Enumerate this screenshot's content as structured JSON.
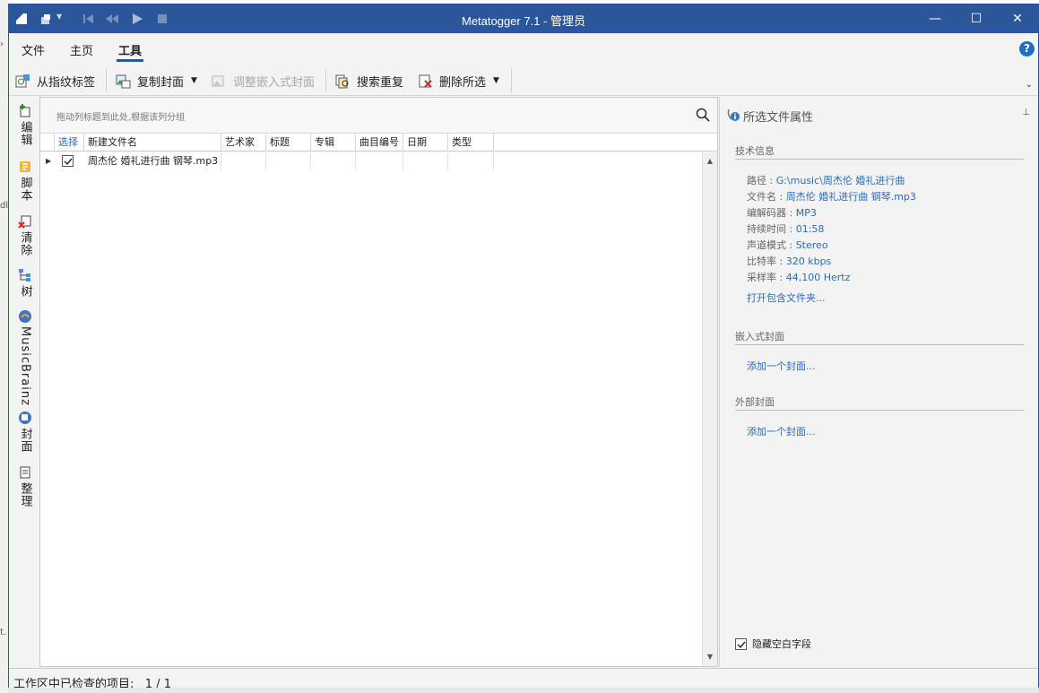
{
  "window": {
    "title": "Metatogger 7.1 - 管理员",
    "controls": {
      "minimize": "—",
      "maximize": "☐",
      "close": "✕"
    }
  },
  "menu": {
    "tabs": [
      {
        "label": "文件"
      },
      {
        "label": "主页"
      },
      {
        "label": "工具",
        "active": true
      }
    ],
    "help": "?"
  },
  "toolbar": {
    "tag_from_fingerprint": "从指纹标签",
    "copy_cover": "复制封面",
    "adjust_embedded_cover": "调整嵌入式封面",
    "search_duplicates": "搜索重复",
    "delete_selected": "删除所选"
  },
  "sidebar": {
    "items": [
      {
        "label": "编辑",
        "icon": "tag-add-icon"
      },
      {
        "label": "脚本",
        "icon": "script-icon"
      },
      {
        "label": "清除",
        "icon": "tag-clear-icon"
      },
      {
        "label": "树",
        "icon": "tree-icon"
      },
      {
        "label": "MusicBrainz",
        "icon": "musicbrainz-icon"
      },
      {
        "label": "封面",
        "icon": "cover-icon"
      },
      {
        "label": "整理",
        "icon": "organize-icon"
      }
    ]
  },
  "grid": {
    "group_hint": "拖动列标题到此处,根据该列分组",
    "columns": [
      "选择",
      "新建文件名",
      "艺术家",
      "标题",
      "专辑",
      "曲目编号",
      "日期",
      "类型"
    ],
    "rows": [
      {
        "selected": true,
        "filename": "周杰伦 婚礼进行曲 钢琴.mp3",
        "artist": "",
        "title": "",
        "album": "",
        "track": "",
        "date": "",
        "genre": ""
      }
    ]
  },
  "properties": {
    "title": "所选文件属性",
    "tech_section": "技术信息",
    "fields": [
      {
        "label": "路径 : ",
        "value": "G:\\music\\周杰伦 婚礼进行曲"
      },
      {
        "label": "文件名 : ",
        "value": "周杰伦 婚礼进行曲 钢琴.mp3"
      },
      {
        "label": "编解码器 : ",
        "value": "MP3"
      },
      {
        "label": "持续时间 : ",
        "value": "01:58"
      },
      {
        "label": "声道模式 : ",
        "value": "Stereo"
      },
      {
        "label": "比特率 : ",
        "value": "320 kbps"
      },
      {
        "label": "采样率 : ",
        "value": "44,100 Hertz"
      }
    ],
    "open_folder": "打开包含文件夹...",
    "embedded_cover_section": "嵌入式封面",
    "add_embedded_cover": "添加一个封面...",
    "external_cover_section": "外部封面",
    "add_external_cover": "添加一个封面...",
    "hide_empty_fields": "隐藏空白字段",
    "hide_empty_checked": true
  },
  "status": {
    "text": "工作区中已检查的项目:   1 / 1"
  },
  "colors": {
    "titlebar": "#2b579a",
    "link": "#2b6cb3"
  }
}
